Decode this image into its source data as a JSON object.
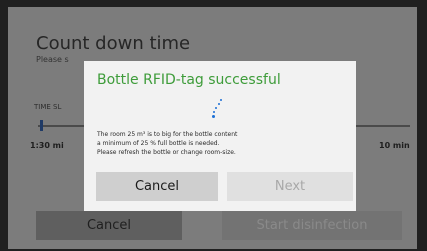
{
  "background": {
    "title": "Count down time",
    "subtitle": "Please s",
    "time_label": "TIME SL",
    "slider_min": "1:30 mi",
    "slider_max": "10 min",
    "cancel_label": "Cancel",
    "start_label": "Start disinfection"
  },
  "dialog": {
    "title": "Bottle RFID-tag successful",
    "message_lines": [
      "The room 25 m³ is to big for the bottle content",
      " a minimum of 25 % full bottle is needed.",
      "Please refresh the bottle or change room-size."
    ],
    "cancel_label": "Cancel",
    "next_label": "Next",
    "spinner_icon": "loading-spinner-icon"
  },
  "colors": {
    "dialog_title": "#3e9c3a",
    "spinner": "#1c6fd6"
  }
}
